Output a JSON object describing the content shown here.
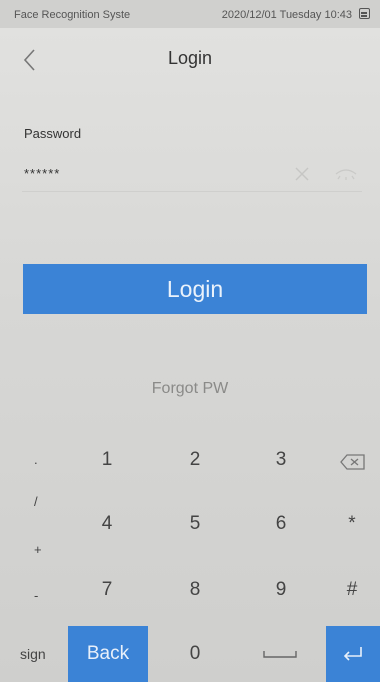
{
  "status_bar": {
    "app_name": "Face Recognition Syste",
    "datetime": "2020/12/01 Tuesday 10:43",
    "icon": "menu-box-icon"
  },
  "header": {
    "title": "Login",
    "back_icon": "chevron-left-icon"
  },
  "password": {
    "label": "Password",
    "value": "******",
    "clear_icon": "close-icon",
    "reveal_icon": "eye-icon"
  },
  "login_button": {
    "label": "Login"
  },
  "forgot_link": {
    "label": "Forgot PW"
  },
  "keypad": {
    "side": {
      "row1": ".",
      "row2_top": "/",
      "row2_bottom": "+",
      "row3": "-",
      "sign": "sign"
    },
    "digits": {
      "k1": "1",
      "k2": "2",
      "k3": "3",
      "k4": "4",
      "k5": "5",
      "k6": "6",
      "k7": "7",
      "k8": "8",
      "k9": "9",
      "k0": "0"
    },
    "star": "*",
    "hash": "#",
    "back": "Back",
    "backspace_icon": "backspace-icon",
    "space_icon": "space-icon",
    "enter_icon": "enter-icon",
    "accent_color": "#3b83d6"
  }
}
